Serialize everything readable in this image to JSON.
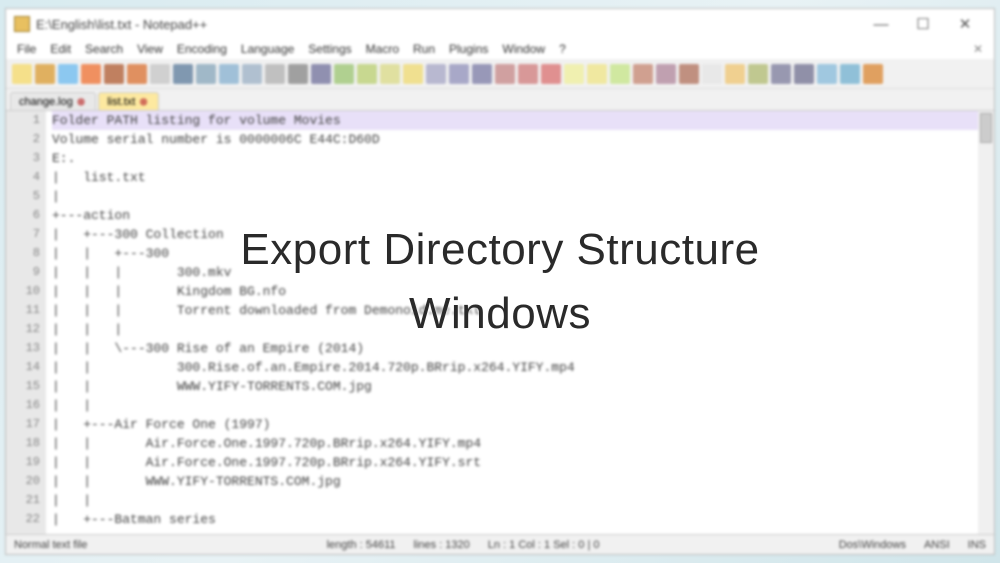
{
  "window": {
    "title": "E:\\English\\list.txt - Notepad++",
    "controls": {
      "min": "—",
      "max": "☐",
      "close": "✕"
    }
  },
  "menu": [
    "File",
    "Edit",
    "Search",
    "View",
    "Encoding",
    "Language",
    "Settings",
    "Macro",
    "Run",
    "Plugins",
    "Window",
    "?"
  ],
  "toolbar_colors": [
    "#f5e08a",
    "#e0b060",
    "#8cc8f0",
    "#f09060",
    "#c08060",
    "#e09060",
    "#d0d0d0",
    "#8098b0",
    "#a0b8c8",
    "#a0c0d8",
    "#b0c0d0",
    "#c0c0c0",
    "#a0a0a0",
    "#9090b0",
    "#b0d090",
    "#c8d890",
    "#e0e0a0",
    "#f0e090",
    "#b8b8d0",
    "#a8a8c8",
    "#9898b8",
    "#d0a0a0",
    "#d89898",
    "#e09090",
    "#f0f0b0",
    "#f0e8a0",
    "#d0e8a0",
    "#d0a090",
    "#c0a0b0",
    "#c09080",
    "#e8e8e8",
    "#f0d090",
    "#c0c890",
    "#9898b0",
    "#9090a8",
    "#a0c8e0",
    "#90c0d8",
    "#e0a060"
  ],
  "tabs": [
    {
      "label": "change.log",
      "active": false
    },
    {
      "label": "list.txt",
      "active": true
    }
  ],
  "editor": {
    "lines": [
      "Folder PATH listing for volume Movies",
      "Volume serial number is 0000006C E44C:D60D",
      "E:.",
      "|   list.txt",
      "|",
      "+---action",
      "|   +---300 Collection",
      "|   |   +---300",
      "|   |   |       300.mkv",
      "|   |   |       Kingdom BG.nfo",
      "|   |   |       Torrent downloaded from Demonoid.me.txt",
      "|   |   |",
      "|   |   \\---300 Rise of an Empire (2014)",
      "|   |           300.Rise.of.an.Empire.2014.720p.BRrip.x264.YIFY.mp4",
      "|   |           WWW.YIFY-TORRENTS.COM.jpg",
      "|   |",
      "|   +---Air Force One (1997)",
      "|   |       Air.Force.One.1997.720p.BRrip.x264.YIFY.mp4",
      "|   |       Air.Force.One.1997.720p.BRrip.x264.YIFY.srt",
      "|   |       WWW.YIFY-TORRENTS.COM.jpg",
      "|   |",
      "|   +---Batman series"
    ]
  },
  "status": {
    "type": "Normal text file",
    "length": "length : 54611",
    "lines": "lines : 1320",
    "pos": "Ln : 1   Col : 1   Sel : 0 | 0",
    "eol": "Dos\\Windows",
    "enc": "ANSI",
    "mode": "INS"
  },
  "overlay": {
    "line1": "Export Directory Structure",
    "line2": "Windows"
  }
}
